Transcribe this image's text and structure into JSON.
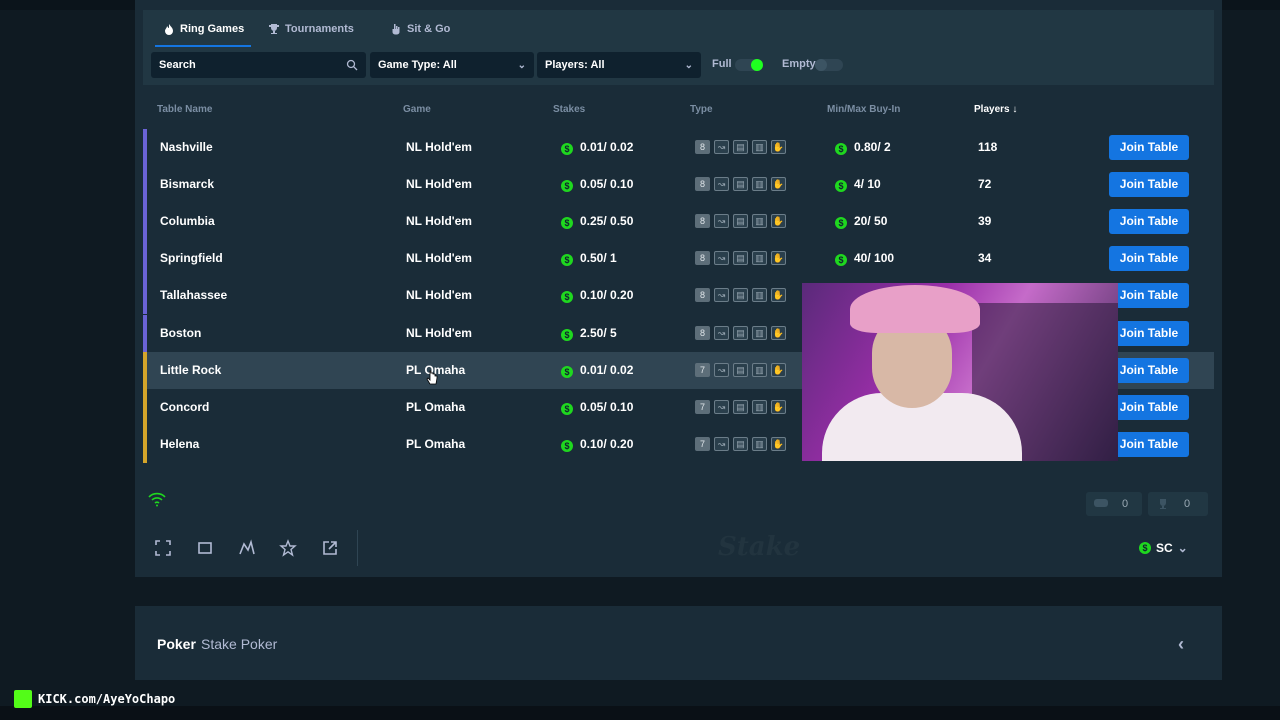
{
  "tabs": [
    {
      "label": "Ring Games",
      "icon": "flame-icon",
      "active": true
    },
    {
      "label": "Tournaments",
      "icon": "trophy-icon",
      "active": false
    },
    {
      "label": "Sit & Go",
      "icon": "hand-icon",
      "active": false
    }
  ],
  "filters": {
    "search_placeholder": "Search",
    "game_type": "Game Type: All",
    "players": "Players: All",
    "full_label": "Full",
    "full_on": true,
    "empty_label": "Empty",
    "empty_on": false
  },
  "columns": [
    "Table Name",
    "Game",
    "Stakes",
    "Type",
    "Min/Max Buy-In",
    "Players ↓"
  ],
  "join_label": "Join Table",
  "rows": [
    {
      "name": "Nashville",
      "game": "NL Hold'em",
      "stakes": "0.01/ 0.02",
      "seats": "8",
      "buyin": "0.80/ 2",
      "players": "118"
    },
    {
      "name": "Bismarck",
      "game": "NL Hold'em",
      "stakes": "0.05/ 0.10",
      "seats": "8",
      "buyin": "4/ 10",
      "players": "72"
    },
    {
      "name": "Columbia",
      "game": "NL Hold'em",
      "stakes": "0.25/ 0.50",
      "seats": "8",
      "buyin": "20/ 50",
      "players": "39"
    },
    {
      "name": "Springfield",
      "game": "NL Hold'em",
      "stakes": "0.50/ 1",
      "seats": "8",
      "buyin": "40/ 100",
      "players": "34"
    },
    {
      "name": "Tallahassee",
      "game": "NL Hold'em",
      "stakes": "0.10/ 0.20",
      "seats": "8",
      "buyin": "",
      "players": ""
    },
    {
      "name": "Boston",
      "game": "NL Hold'em",
      "stakes": "2.50/ 5",
      "seats": "8",
      "buyin": "",
      "players": ""
    },
    {
      "name": "Little Rock",
      "game": "PL Omaha",
      "stakes": "0.01/ 0.02",
      "seats": "7",
      "buyin": "",
      "players": ""
    },
    {
      "name": "Concord",
      "game": "PL Omaha",
      "stakes": "0.05/ 0.10",
      "seats": "7",
      "buyin": "",
      "players": ""
    },
    {
      "name": "Helena",
      "game": "PL Omaha",
      "stakes": "0.10/ 0.20",
      "seats": "7",
      "buyin": "",
      "players": ""
    }
  ],
  "counters": {
    "chat": "0",
    "tournaments": "0"
  },
  "currency": "SC",
  "watermark": "Stake",
  "footer": {
    "title": "Poker",
    "subtitle": "Stake Poker"
  },
  "overlay": {
    "kick_text": "KICK.com/AyeYoChapo"
  },
  "colors": {
    "accent": "#1475e1",
    "green": "#1fd81f",
    "holdem_bar": "#6b63d6",
    "omaha_bar": "#d4a52a"
  }
}
